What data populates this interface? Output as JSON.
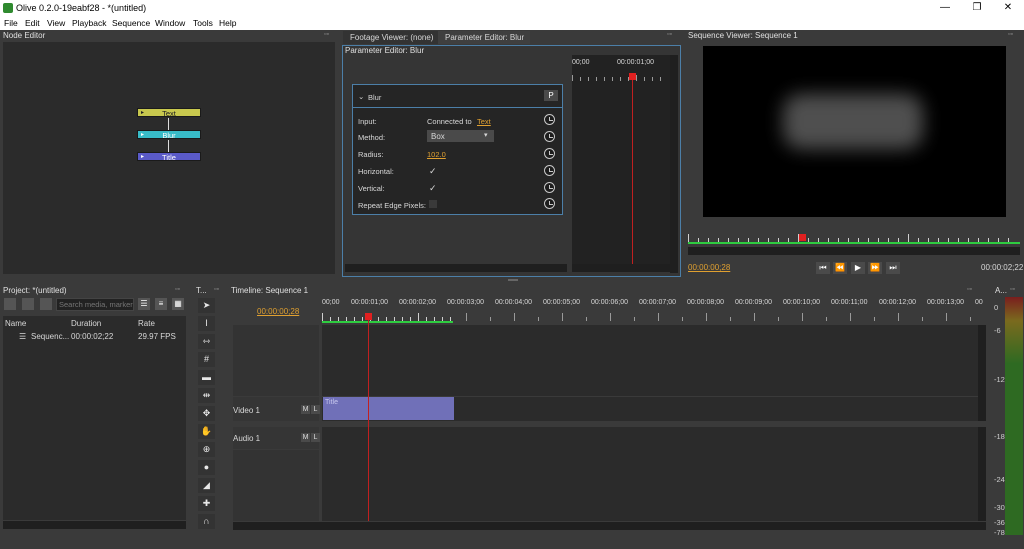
{
  "window": {
    "title": "Olive 0.2.0-19eabf28 - *(untitled)",
    "minimize": "—",
    "maximize": "❐",
    "close": "✕"
  },
  "menu": [
    "File",
    "Edit",
    "View",
    "Playback",
    "Sequence",
    "Window",
    "Tools",
    "Help"
  ],
  "node_editor": {
    "title": "Node Editor",
    "nodes": [
      "Text",
      "Blur",
      "Title"
    ]
  },
  "tabs": {
    "footage": "Footage Viewer: (none)",
    "param": "Parameter Editor: Blur"
  },
  "param_editor": {
    "title": "Parameter Editor: Blur",
    "node": "Blur",
    "p_button": "P",
    "input_label": "Input:",
    "input_value": "Connected to",
    "input_link": "Text",
    "method_label": "Method:",
    "method_value": "Box",
    "radius_label": "Radius:",
    "radius_value": "102.0",
    "horizontal_label": "Horizontal:",
    "vertical_label": "Vertical:",
    "repeat_label": "Repeat Edge Pixels:",
    "check": "✓",
    "ruler_start": "00;00",
    "ruler_mark": "00:00:01;00"
  },
  "seq_viewer": {
    "title": "Sequence Viewer: Sequence 1",
    "current": "00:00:00;28",
    "end": "00:00:02;22"
  },
  "project": {
    "title": "Project: *(untitled)",
    "search_placeholder": "Search media, markers...",
    "cols": [
      "Name",
      "Duration",
      "Rate"
    ],
    "rows": [
      {
        "name": "Sequenc...",
        "duration": "00:00:02;22",
        "rate": "29.97 FPS"
      }
    ]
  },
  "tools": {
    "title": "T..."
  },
  "timeline": {
    "title": "Timeline: Sequence 1",
    "current": "00:00:00;28",
    "ruler": [
      "00;00",
      "00:00:01;00",
      "00:00:02;00",
      "00:00:03;00",
      "00:00:04;00",
      "00:00:05;00",
      "00:00:06;00",
      "00:00:07;00",
      "00:00:08;00",
      "00:00:09;00",
      "00:00:10;00",
      "00:00:11;00",
      "00:00:12;00",
      "00:00:13;00",
      "00"
    ],
    "video_track": "Video 1",
    "audio_track": "Audio 1",
    "mute": "M",
    "lock": "L",
    "clip": "Title"
  },
  "audio_monitor": {
    "title": "A...",
    "db": [
      "0",
      "-6",
      "-12",
      "-18",
      "-24",
      "-30",
      "-36",
      "-78"
    ]
  }
}
